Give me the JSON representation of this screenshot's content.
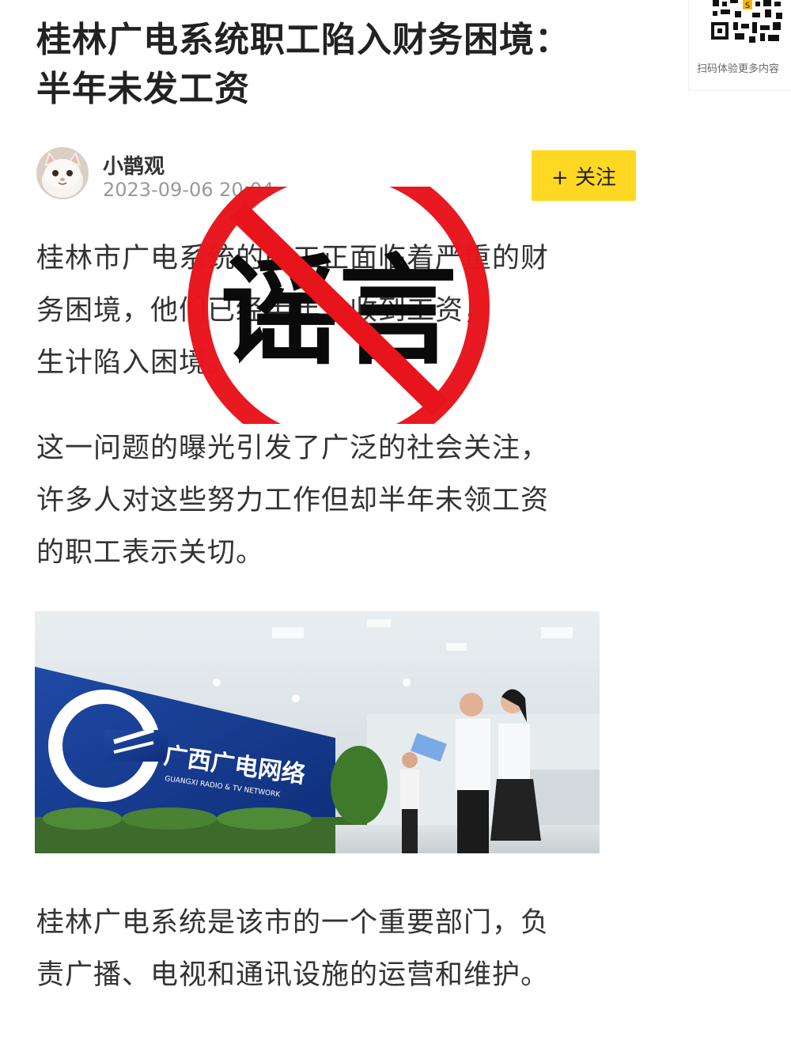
{
  "article": {
    "title_lines": [
      "桂林广电系统职工陷入财务困境：",
      "半年未发工资"
    ],
    "author": "小鹊观",
    "date": "2023-09-06 20:04",
    "follow_label": "+ 关注",
    "paragraphs": [
      [
        "桂林市广电系统的职工正面临着严重的财",
        "务困境，他们已经半年未收到工资，",
        "生计陷入困境。"
      ],
      [
        "这一问题的曝光引发了广泛的社会关注，",
        "许多人对这些努力工作但却半年未领工资",
        "的职工表示关切。"
      ],
      [
        "桂林广电系统是该市的一个重要部门，负",
        "责广播、电视和通讯设施的运营和维护。"
      ]
    ],
    "image": {
      "logo_cn": "广西广电网络",
      "logo_en": "GUANGXI RADIO & TV NETWORK"
    }
  },
  "qr": {
    "caption": "扫码体验更多内容"
  },
  "stamp": {
    "text": "谣言",
    "color": "#e8141c"
  }
}
